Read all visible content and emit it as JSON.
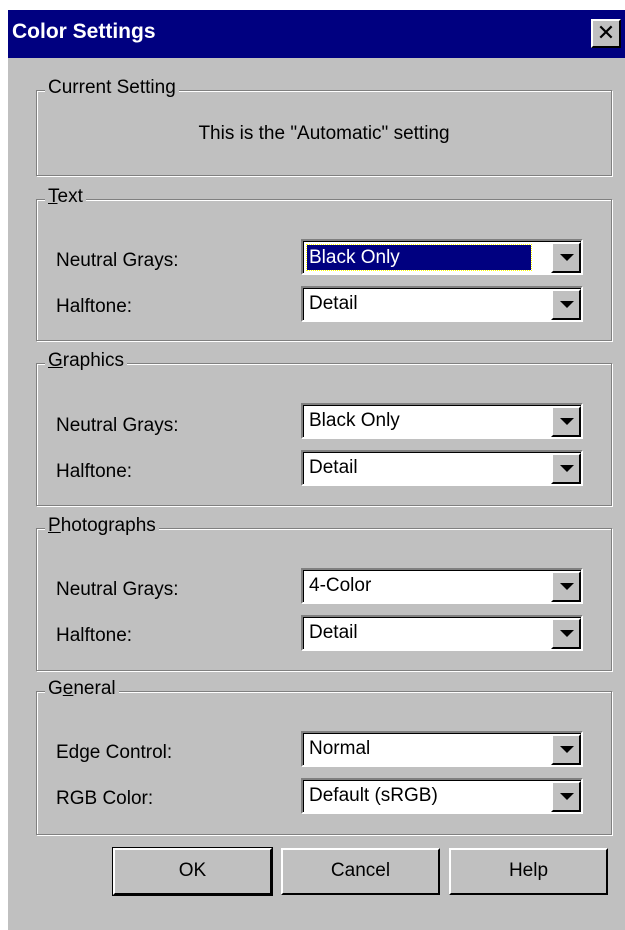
{
  "window": {
    "title": "Color Settings",
    "close_glyph": "✕"
  },
  "current_setting": {
    "legend": "Current Setting",
    "text": "This is the \"Automatic\" setting"
  },
  "text_group": {
    "legend_mnemonic": "T",
    "legend_rest": "ext",
    "neutral_grays_label": "Neutral Grays:",
    "neutral_grays_value": "Black Only",
    "halftone_label": "Halftone:",
    "halftone_value": "Detail"
  },
  "graphics_group": {
    "legend_mnemonic": "G",
    "legend_rest": "raphics",
    "neutral_grays_label": "Neutral Grays:",
    "neutral_grays_value": "Black Only",
    "halftone_label": "Halftone:",
    "halftone_value": "Detail"
  },
  "photographs_group": {
    "legend_mnemonic": "P",
    "legend_rest": "hotographs",
    "neutral_grays_label": "Neutral Grays:",
    "neutral_grays_value": "4-Color",
    "halftone_label": "Halftone:",
    "halftone_value": "Detail"
  },
  "general_group": {
    "legend_pre": "G",
    "legend_mnemonic": "e",
    "legend_rest": "neral",
    "edge_control_label": "Edge Control:",
    "edge_control_value": "Normal",
    "rgb_color_label": "RGB Color:",
    "rgb_color_value": "Default (sRGB)"
  },
  "buttons": {
    "ok": "OK",
    "cancel": "Cancel",
    "help": "Help"
  },
  "colors": {
    "title_bar": "#000080",
    "dialog_face": "#c0c0c0",
    "selection": "#000080"
  }
}
